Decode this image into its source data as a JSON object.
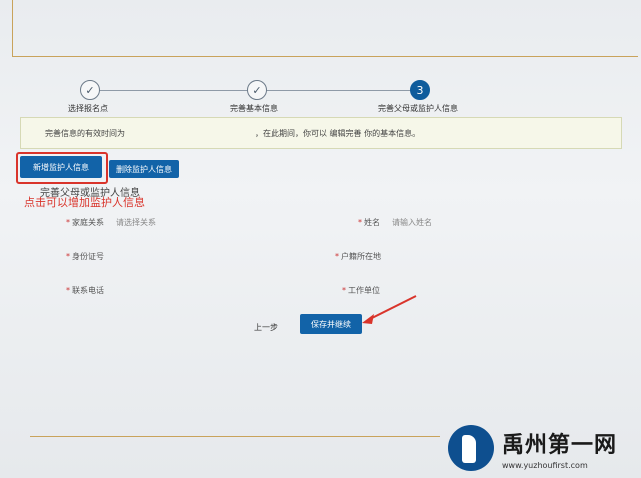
{
  "steps": [
    {
      "label": "选择报名点",
      "state": "done"
    },
    {
      "label": "完善基本信息",
      "state": "done"
    },
    {
      "label": "完善父母或监护人信息",
      "state": "current",
      "number": "3"
    }
  ],
  "notice": {
    "part1": "完善信息的有效时间为",
    "part2": "，在此期间，你可以  编辑完善  你的基本信息。"
  },
  "buttons": {
    "add_guardian": "新增监护人信息",
    "delete_guardian": "删除监护人信息",
    "prev": "上一步",
    "save_continue": "保存并继续"
  },
  "section_title": "完善父母或监护人信息",
  "annotation": "点击可以增加监护人信息",
  "fields": {
    "relation": {
      "label": "家庭关系",
      "placeholder": "请选择关系"
    },
    "name": {
      "label": "姓名",
      "placeholder": "请输入姓名"
    },
    "id_card": {
      "label": "身份证号"
    },
    "household": {
      "label": "户籍所在地"
    },
    "phone": {
      "label": "联系电话"
    },
    "work": {
      "label": "工作单位"
    }
  },
  "logo": {
    "name": "禹州第一网",
    "url": "www.yuzhoufirst.com"
  },
  "colors": {
    "primary": "#1263a8",
    "annotation": "#d9342b",
    "accent_line": "#c9a35b"
  }
}
